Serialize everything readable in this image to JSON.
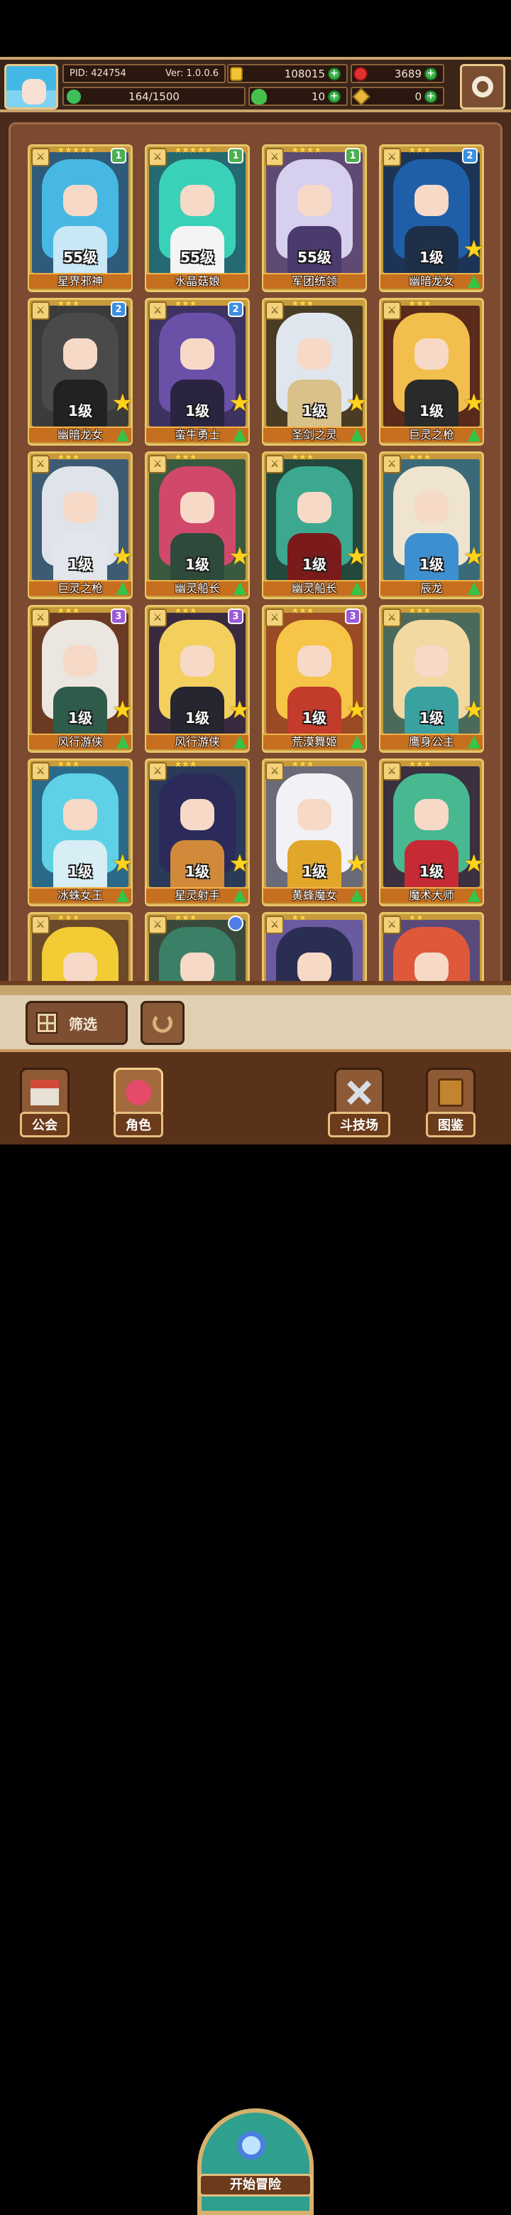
{
  "hud": {
    "pid": "PID: 424754",
    "version": "Ver: 1.0.0.6",
    "gold": "108015",
    "gems": "3689",
    "energy": "164/1500",
    "clover": "10",
    "keys": "0"
  },
  "cards": [
    {
      "name": "星界邪神",
      "level": "55级",
      "stars": "★★★★★",
      "rank": "1",
      "rank_color": "#4caf50",
      "hair": "#47b8e3",
      "body": "#c9e7f4",
      "bg": "#2f5b7a",
      "upgradable": false
    },
    {
      "name": "水晶菇娘",
      "level": "55级",
      "stars": "★★★★★",
      "rank": "1",
      "rank_color": "#4caf50",
      "hair": "#3ad1b9",
      "body": "#f4f4f4",
      "bg": "#246a70",
      "upgradable": false
    },
    {
      "name": "军团统领",
      "level": "55级",
      "stars": "★★★★",
      "rank": "1",
      "rank_color": "#4caf50",
      "hair": "#d6d0ee",
      "body": "#4b3a6e",
      "bg": "#5e4a72",
      "upgradable": false
    },
    {
      "name": "幽暗龙女",
      "level": "1级",
      "stars": "★★★",
      "rank": "2",
      "rank_color": "#3b8fe0",
      "hair": "#1f5fa8",
      "body": "#1d3047",
      "bg": "#1c3556",
      "upgradable": true
    },
    {
      "name": "幽暗龙女",
      "level": "1级",
      "stars": "★★★",
      "rank": "2",
      "rank_color": "#3b8fe0",
      "hair": "#4a4a4a",
      "body": "#222",
      "bg": "#3b3b3b",
      "upgradable": true
    },
    {
      "name": "蛮牛勇士",
      "level": "1级",
      "stars": "★★★",
      "rank": "2",
      "rank_color": "#3b8fe0",
      "hair": "#6b50a8",
      "body": "#2a2440",
      "bg": "#3e3260",
      "upgradable": true
    },
    {
      "name": "圣剑之灵",
      "level": "1级",
      "stars": "★★★",
      "rank": "",
      "rank_color": "",
      "hair": "#dfe6ee",
      "body": "#d8c28a",
      "bg": "#4a3c24",
      "upgradable": true
    },
    {
      "name": "巨灵之枪",
      "level": "1级",
      "stars": "★★★",
      "rank": "",
      "rank_color": "",
      "hair": "#f2bf4c",
      "body": "#2a2a2a",
      "bg": "#5a2a1a",
      "upgradable": true
    },
    {
      "name": "巨灵之枪",
      "level": "1级",
      "stars": "★★★",
      "rank": "",
      "rank_color": "",
      "hair": "#dfe4ea",
      "body": "#e2e6ec",
      "bg": "#3e5b74",
      "upgradable": true
    },
    {
      "name": "幽灵船长",
      "level": "1级",
      "stars": "★★★",
      "rank": "",
      "rank_color": "",
      "hair": "#d0486a",
      "body": "#2d4a3a",
      "bg": "#3a5a40",
      "upgradable": true
    },
    {
      "name": "幽灵船长",
      "level": "1级",
      "stars": "★★★",
      "rank": "",
      "rank_color": "",
      "hair": "#3ba88f",
      "body": "#7b1a1a",
      "bg": "#24483c",
      "upgradable": true
    },
    {
      "name": "辰龙",
      "level": "1级",
      "stars": "★★★",
      "rank": "",
      "rank_color": "",
      "hair": "#efe4cf",
      "body": "#3e8fd0",
      "bg": "#3a6a78",
      "upgradable": true
    },
    {
      "name": "风行游侠",
      "level": "1级",
      "stars": "★★★",
      "rank": "3",
      "rank_color": "#9c5bd6",
      "hair": "#ece6e0",
      "body": "#2e5b4a",
      "bg": "#6a3a22",
      "upgradable": true
    },
    {
      "name": "风行游侠",
      "level": "1级",
      "stars": "★★★",
      "rank": "3",
      "rank_color": "#9c5bd6",
      "hair": "#f3cf5e",
      "body": "#262630",
      "bg": "#3a2a40",
      "upgradable": true
    },
    {
      "name": "荒漠舞姬",
      "level": "1级",
      "stars": "★★★",
      "rank": "3",
      "rank_color": "#9c5bd6",
      "hair": "#f6c447",
      "body": "#c23b2b",
      "bg": "#9a4a24",
      "upgradable": true
    },
    {
      "name": "鹰身公主",
      "level": "1级",
      "stars": "★★★",
      "rank": "",
      "rank_color": "",
      "hair": "#f2d9a2",
      "body": "#3aa1a1",
      "bg": "#4c6a5a",
      "upgradable": true
    },
    {
      "name": "冰蛛女王",
      "level": "1级",
      "stars": "★★★",
      "rank": "",
      "rank_color": "",
      "hair": "#5fd1e6",
      "body": "#d6eef4",
      "bg": "#2a6a88",
      "upgradable": true
    },
    {
      "name": "星灵射手",
      "level": "1级",
      "stars": "★★★",
      "rank": "",
      "rank_color": "",
      "hair": "#2b2a5a",
      "body": "#d08a3a",
      "bg": "#2a3a58",
      "upgradable": true
    },
    {
      "name": "黄蜂魔女",
      "level": "1级",
      "stars": "★★★",
      "rank": "",
      "rank_color": "",
      "hair": "#f2f2f6",
      "body": "#e2a62a",
      "bg": "#6a6a78",
      "upgradable": true
    },
    {
      "name": "魔术大师",
      "level": "1级",
      "stars": "★★★",
      "rank": "",
      "rank_color": "",
      "hair": "#48b890",
      "body": "#c62a34",
      "bg": "#3a3040",
      "upgradable": true
    },
    {
      "name": "",
      "level": "",
      "stars": "★★★",
      "rank": "",
      "rank_color": "",
      "hair": "#f2cc34",
      "body": "#f2cc34",
      "bg": "#6a4a2a",
      "upgradable": false
    },
    {
      "name": "",
      "level": "",
      "stars": "★★★",
      "rank": "",
      "rank_color": "#4f7fe6",
      "hair": "#3b7f66",
      "body": "#2a4a3e",
      "bg": "#3a4a3a",
      "upgradable": false
    },
    {
      "name": "",
      "level": "",
      "stars": "★★",
      "rank": "",
      "rank_color": "",
      "hair": "#2a2e52",
      "body": "#4a8a3a",
      "bg": "#6a5aa0",
      "upgradable": false
    },
    {
      "name": "",
      "level": "",
      "stars": "★★",
      "rank": "",
      "rank_color": "",
      "hair": "#e0583a",
      "body": "#3a2a2a",
      "bg": "#5a4a7a",
      "upgradable": false
    }
  ],
  "toolbar": {
    "filter_label": "筛选"
  },
  "nav": {
    "guild": "公会",
    "role": "角色",
    "adventure": "开始冒险",
    "arena": "斗技场",
    "codex": "图鉴"
  }
}
